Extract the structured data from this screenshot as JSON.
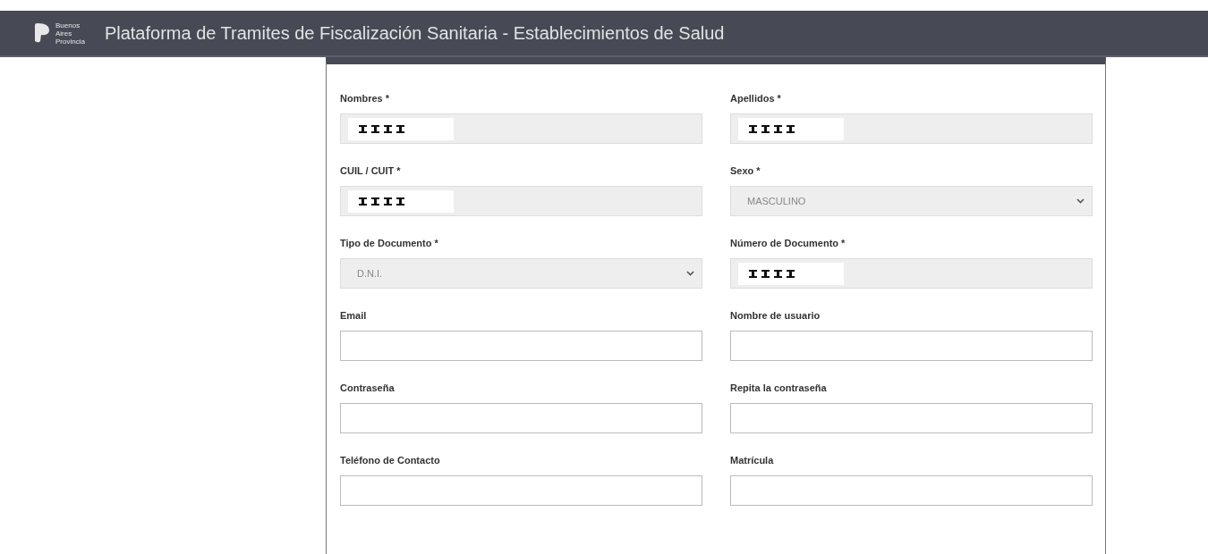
{
  "header": {
    "logo_text": [
      "Buenos",
      "Aires",
      "Provincia"
    ],
    "title": "Plataforma de Tramites de Fiscalización Sanitaria - Establecimientos de Salud"
  },
  "form": {
    "fields": [
      {
        "label": "Nombres *",
        "kind": "text",
        "disabled": true,
        "redacted": true
      },
      {
        "label": "Apellidos *",
        "kind": "text",
        "disabled": true,
        "redacted": true
      },
      {
        "label": "CUIL / CUIT *",
        "kind": "text",
        "disabled": true,
        "redacted": true
      },
      {
        "label": "Sexo *",
        "kind": "select",
        "disabled": true,
        "value": "MASCULINO"
      },
      {
        "label": "Tipo de Documento *",
        "kind": "select",
        "disabled": true,
        "value": "D.N.I."
      },
      {
        "label": "Número de Documento *",
        "kind": "text",
        "disabled": true,
        "redacted": true
      },
      {
        "label": "Email",
        "kind": "text",
        "disabled": false,
        "redacted": false
      },
      {
        "label": "Nombre de usuario",
        "kind": "text",
        "disabled": false,
        "redacted": false
      },
      {
        "label": "Contraseña",
        "kind": "text",
        "disabled": false,
        "redacted": false
      },
      {
        "label": "Repita la contraseña",
        "kind": "text",
        "disabled": false,
        "redacted": false
      },
      {
        "label": "Teléfono de Contacto",
        "kind": "text",
        "disabled": false,
        "redacted": false
      },
      {
        "label": "Matrícula",
        "kind": "text",
        "disabled": false,
        "redacted": false
      }
    ]
  }
}
